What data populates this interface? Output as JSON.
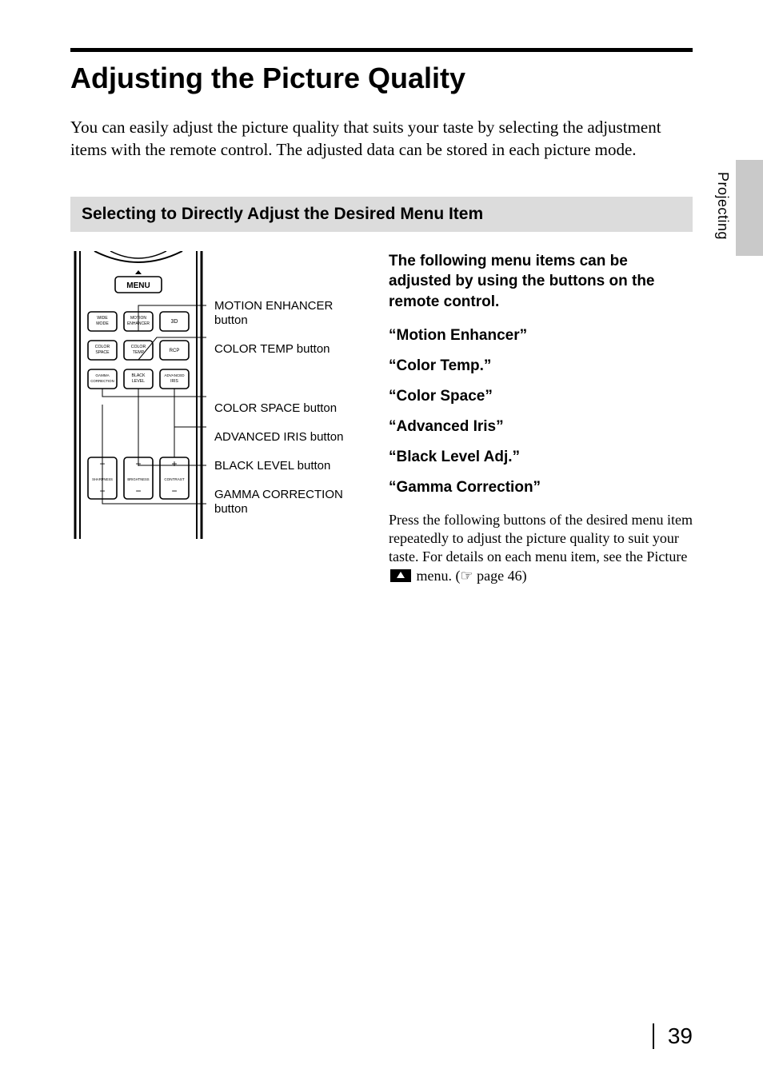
{
  "section_label": "Projecting",
  "title": "Adjusting the Picture Quality",
  "intro": "You can easily adjust the picture quality that suits your taste by selecting the adjustment items with the remote control. The adjusted data can be stored in each picture mode.",
  "subhead": "Selecting to Directly Adjust the Desired Menu Item",
  "remote": {
    "buttons": {
      "menu": "MENU",
      "wide_mode": "WIDE MODE",
      "motion_enhancer": "MOTION ENHANCER",
      "three_d": "3D",
      "color_space": "COLOR SPACE",
      "color_temp": "COLOR TEMP",
      "rcp": "RCP",
      "gamma_correction": "GAMMA CORRECTION",
      "black_level": "BLACK LEVEL",
      "advanced_iris": "ADVANCED IRIS",
      "sharpness": "SHARPNESS",
      "brightness": "BRIGHTNESS",
      "contrast": "CONTRAST"
    },
    "callouts": [
      "MOTION ENHANCER button",
      "COLOR TEMP button",
      "COLOR SPACE button",
      "ADVANCED IRIS button",
      "BLACK LEVEL button",
      "GAMMA CORRECTION button"
    ]
  },
  "right": {
    "lead": "The following menu items can be adjusted by using the buttons on the remote control.",
    "items": [
      "“Motion Enhancer”",
      "“Color Temp.”",
      "“Color Space”",
      "“Advanced Iris”",
      "“Black Level Adj.”",
      "“Gamma Correction”"
    ],
    "body_before_icon": "Press the following buttons of the desired menu item repeatedly to adjust the picture quality to suit your taste. For details on each menu item, see the Picture ",
    "body_after_icon": " menu. (",
    "page_ref": " page 46)",
    "pointer_glyph": "☞"
  },
  "page_number": "39"
}
